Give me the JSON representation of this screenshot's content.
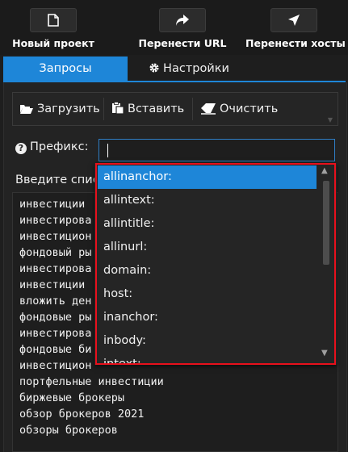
{
  "toolbar": {
    "new_project": "Новый проект",
    "transfer_url": "Перенести URL",
    "transfer_hosts": "Перенести хосты",
    "icons": [
      "file-icon",
      "share-arrow-icon",
      "location-arrow-icon"
    ]
  },
  "tabs": {
    "requests": "Запросы",
    "settings": "Настройки"
  },
  "actions": {
    "load": "Загрузить",
    "paste": "Вставить",
    "clear": "Очистить"
  },
  "prefix": {
    "label": "Префикс:",
    "value": ""
  },
  "list_label": "Введите список",
  "queries": [
    "инвестиции",
    "инвестирова",
    "инвестицион",
    "фондовый ры",
    "инвестирова",
    "инвестиции",
    "вложить ден",
    "фондовые ры",
    "инвестирова",
    "фондовые би",
    "инвестицион",
    "портфельные инвестиции",
    "биржевые брокеры",
    "обзор брокеров 2021",
    "обзоры брокеров"
  ],
  "dropdown": {
    "items": [
      "allinanchor:",
      "allintext:",
      "allintitle:",
      "allinurl:",
      "domain:",
      "host:",
      "inanchor:",
      "inbody:",
      "intext:"
    ],
    "selected_index": 0
  },
  "colors": {
    "accent": "#1e86d8",
    "highlight_frame": "#e8101c",
    "background": "#1e1e1e"
  }
}
